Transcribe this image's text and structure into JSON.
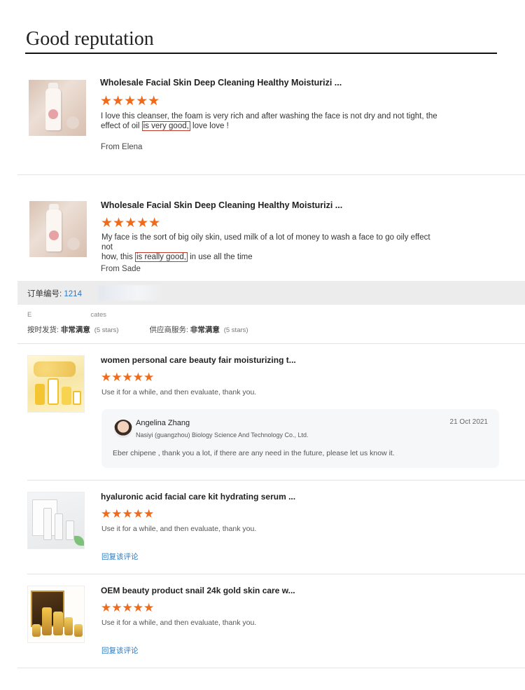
{
  "heading": "Good reputation",
  "top_reviews": [
    {
      "product_title": "Wholesale Facial Skin Deep Cleaning Healthy Moisturizi ...",
      "stars": "★★★★★",
      "rating": 5,
      "text_line1": "I love this cleanser, the foam is very rich and after washing the face is not dry and not tight, the",
      "text_line2_pre": "effect of oil ",
      "text_highlight": "is very good,",
      "text_line2_post": " love love !",
      "from": "From Elena"
    },
    {
      "product_title": "Wholesale Facial Skin Deep Cleaning Healthy Moisturizi ...",
      "stars": "★★★★★",
      "rating": 5,
      "text_line1": "My face is the sort of big oily skin, used milk of a lot of money to wash a face to go oily effect not",
      "text_line2_pre": " how, this ",
      "text_highlight": "is really good,",
      "text_line2_post": " in use all the time",
      "from": "From Sade"
    }
  ],
  "order": {
    "label": "订单编号: ",
    "number": "1214",
    "sub_pre": "E",
    "sub_post": "cates",
    "delivery_label": "按时发货: ",
    "delivery_value": "非常满意",
    "delivery_stars": "(5 stars)",
    "service_label": "供应商服务: ",
    "service_value": "非常满意",
    "service_stars": "(5 stars)"
  },
  "product_reviews": [
    {
      "title": "women personal care beauty fair moisturizing t...",
      "stars": "★★★★★",
      "rating": 5,
      "text": "Use it for a while, and then evaluate, thank you.",
      "seller_reply": {
        "name": "Angelina Zhang",
        "company": "Nasiyi (guangzhou) Biology Science And Technology Co., Ltd.",
        "date": "21 Oct 2021",
        "text": "Eber chipene , thank you a lot, if there are any need in the future, please let us know it."
      }
    },
    {
      "title": "hyaluronic acid facial care kit hydrating serum ...",
      "stars": "★★★★★",
      "rating": 5,
      "text": "Use it for a while, and then evaluate, thank you.",
      "reply_link": "回复该评论"
    },
    {
      "title": "OEM beauty product snail 24k gold skin care w...",
      "stars": "★★★★★",
      "rating": 5,
      "text": "Use it for a while, and then evaluate, thank you.",
      "reply_link": "回复该评论"
    }
  ],
  "colors": {
    "star": "#f06a1c",
    "link": "#2a7ac2",
    "highlight_border": "#c0392b"
  }
}
